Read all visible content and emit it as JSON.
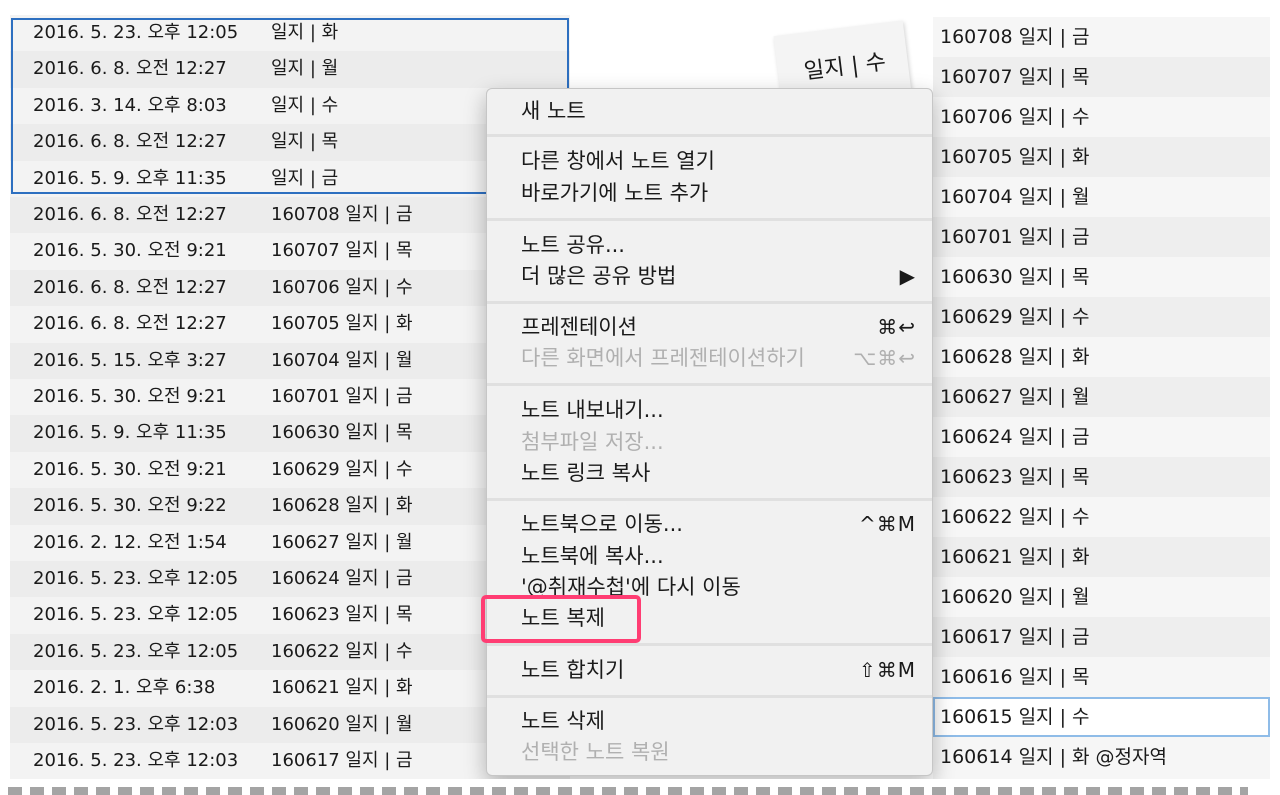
{
  "left_list": {
    "rows": [
      {
        "date": "2016. 5. 23. 오후 12:05",
        "title": "일지 | 화"
      },
      {
        "date": "2016. 6. 8. 오전 12:27",
        "title": "일지 | 월"
      },
      {
        "date": "2016. 3. 14. 오후 8:03",
        "title": "일지 | 수"
      },
      {
        "date": "2016. 6. 8. 오전 12:27",
        "title": "일지 | 목"
      },
      {
        "date": "2016. 5. 9. 오후 11:35",
        "title": "일지 | 금"
      },
      {
        "date": "2016. 6. 8. 오전 12:27",
        "title": "160708 일지 | 금"
      },
      {
        "date": "2016. 5. 30. 오전 9:21",
        "title": "160707 일지 | 목"
      },
      {
        "date": "2016. 6. 8. 오전 12:27",
        "title": "160706 일지 | 수"
      },
      {
        "date": "2016. 6. 8. 오전 12:27",
        "title": "160705 일지 | 화"
      },
      {
        "date": "2016. 5. 15. 오후 3:27",
        "title": "160704 일지 | 월"
      },
      {
        "date": "2016. 5. 30. 오전 9:21",
        "title": "160701 일지 | 금"
      },
      {
        "date": "2016. 5. 9. 오후 11:35",
        "title": "160630 일지 | 목"
      },
      {
        "date": "2016. 5. 30. 오전 9:21",
        "title": "160629 일지 | 수"
      },
      {
        "date": "2016. 5. 30. 오전 9:22",
        "title": "160628 일지 | 화"
      },
      {
        "date": "2016. 2. 12. 오전 1:54",
        "title": "160627 일지 | 월"
      },
      {
        "date": "2016. 5. 23. 오후 12:05",
        "title": "160624 일지 | 금"
      },
      {
        "date": "2016. 5. 23. 오후 12:05",
        "title": "160623 일지 | 목"
      },
      {
        "date": "2016. 5. 23. 오후 12:05",
        "title": "160622 일지 | 수"
      },
      {
        "date": "2016. 2. 1. 오후 6:38",
        "title": "160621 일지 | 화"
      },
      {
        "date": "2016. 5. 23. 오후 12:03",
        "title": "160620 일지 | 월"
      },
      {
        "date": "2016. 5. 23. 오후 12:03",
        "title": "160617 일지 | 금"
      }
    ]
  },
  "drag_card": {
    "title": "일지 | 수"
  },
  "right_list": {
    "rows": [
      "160708 일지 | 금",
      "160707 일지 | 목",
      "160706 일지 | 수",
      "160705 일지 | 화",
      "160704 일지 | 월",
      "160701 일지 | 금",
      "160630 일지 | 목",
      "160629 일지 | 수",
      "160628 일지 | 화",
      "160627 일지 | 월",
      "160624 일지 | 금",
      "160623 일지 | 목",
      "160622 일지 | 수",
      "160621 일지 | 화",
      "160620 일지 | 월",
      "160617 일지 | 금",
      "160616 일지 | 목",
      "160615 일지 | 수",
      "160614 일지 | 화 @정자역"
    ]
  },
  "context_menu": {
    "new_note": "새 노트",
    "open_in_new_window": "다른 창에서 노트 열기",
    "add_shortcut": "바로가기에 노트 추가",
    "share_note": "노트 공유...",
    "more_share": "더 많은 공유 방법",
    "more_share_arrow": "▶",
    "presentation": "프레젠테이션",
    "presentation_shortcut": "⌘↩",
    "present_other_screen": "다른 화면에서 프레젠테이션하기",
    "present_other_screen_shortcut": "⌥⌘↩",
    "export_note": "노트 내보내기...",
    "save_attachments": "첨부파일 저장...",
    "copy_note_link": "노트 링크 복사",
    "move_to_notebook": "노트북으로 이동...",
    "move_to_notebook_shortcut": "^⌘M",
    "copy_to_notebook": "노트북에 복사...",
    "move_again": "'@취재수첩'에 다시 이동",
    "duplicate_note": "노트 복제",
    "merge_notes": "노트 합치기",
    "merge_notes_shortcut": "⇧⌘M",
    "delete_note": "노트 삭제",
    "restore_selected": "선택한 노트 복원"
  },
  "colors": {
    "selection_border": "#2d6fc0",
    "highlight": "#ff3d73",
    "focus_ring": "#8fbce8"
  }
}
